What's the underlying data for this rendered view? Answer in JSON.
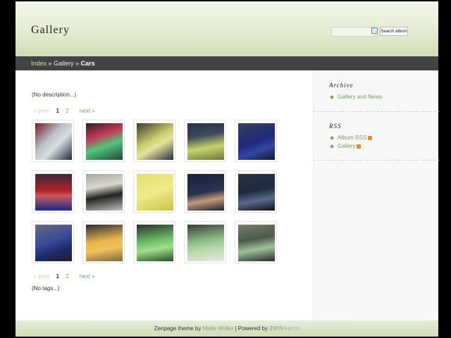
{
  "header": {
    "title": "Gallery"
  },
  "search": {
    "placeholder": "",
    "button_label": "Search album"
  },
  "breadcrumb": {
    "index": "Index",
    "sep1": "»",
    "gallery": "Gallery",
    "sep2": "»",
    "current": "Cars"
  },
  "album": {
    "description": "(No description...)",
    "tags": "(No tags...)"
  },
  "pager_top": {
    "prev": "« prev",
    "page1": "1",
    "page2": "2",
    "next": "next »"
  },
  "pager_bottom": {
    "prev": "« prev",
    "page1": "1",
    "page2": "2",
    "next": "next »"
  },
  "sidebar": {
    "archive_heading": "Archive",
    "archive_item": "Gallery and News",
    "rss_heading": "RSS",
    "rss_items": [
      "Album RSS",
      "Gallery"
    ]
  },
  "footer": {
    "text1": "Zenpage theme by",
    "author": "Malte Müller",
    "text2": "| Powered by",
    "zen": "zen",
    "photo": "PHOTO"
  },
  "colors": {
    "accent": "#7a9d63",
    "nav_bg": "#434343",
    "header_bg": "#dfe8cc"
  }
}
